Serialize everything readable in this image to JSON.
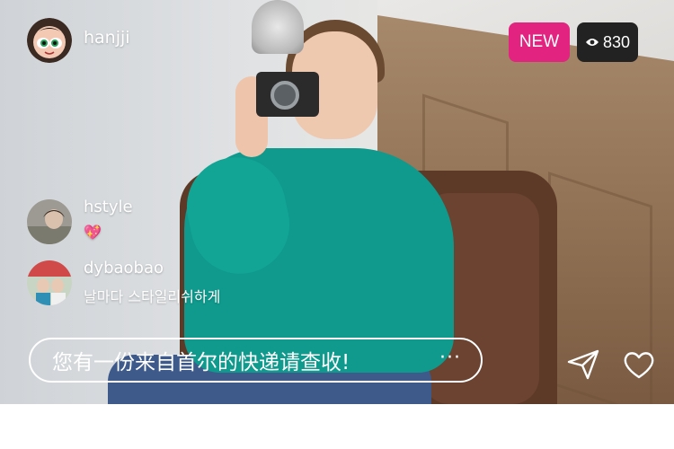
{
  "host": {
    "name": "hanjji",
    "avatar_icon": "powerpuff-avatar"
  },
  "badges": {
    "new_label": "NEW",
    "new_color": "#e2237f",
    "views_count": "830",
    "views_bg": "#222222",
    "views_icon": "eye-icon"
  },
  "comments": [
    {
      "user": "hstyle",
      "text": "💖",
      "avatar_icon": "user-photo-avatar"
    },
    {
      "user": "dybaobao",
      "text": "날마다  스타일리쉬하게",
      "avatar_icon": "user-photo-avatar"
    }
  ],
  "chat": {
    "text": "您有一份来自首尔的快递请查收!",
    "more": "···"
  },
  "actions": {
    "send_icon": "send-icon",
    "like_icon": "heart-icon"
  }
}
